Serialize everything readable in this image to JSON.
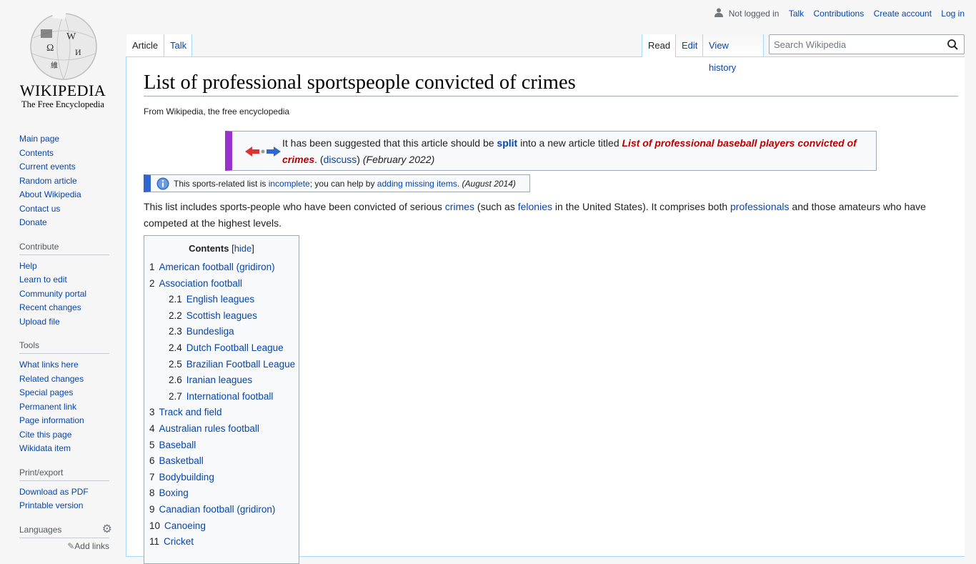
{
  "logo": {
    "wordmark": "WIKIPEDIA",
    "tagline": "The Free Encyclopedia"
  },
  "personal": {
    "not_logged_in": "Not logged in",
    "talk": "Talk",
    "contributions": "Contributions",
    "create_account": "Create account",
    "log_in": "Log in"
  },
  "tabs": {
    "article": "Article",
    "talk": "Talk",
    "read": "Read",
    "edit": "Edit",
    "view_history": "View history"
  },
  "search": {
    "placeholder": "Search Wikipedia"
  },
  "sidebar": {
    "main": [
      "Main page",
      "Contents",
      "Current events",
      "Random article",
      "About Wikipedia",
      "Contact us",
      "Donate"
    ],
    "contribute": {
      "heading": "Contribute",
      "items": [
        "Help",
        "Learn to edit",
        "Community portal",
        "Recent changes",
        "Upload file"
      ]
    },
    "tools": {
      "heading": "Tools",
      "items": [
        "What links here",
        "Related changes",
        "Special pages",
        "Permanent link",
        "Page information",
        "Cite this page",
        "Wikidata item"
      ]
    },
    "print": {
      "heading": "Print/export",
      "items": [
        "Download as PDF",
        "Printable version"
      ]
    },
    "languages": {
      "heading": "Languages",
      "add_links": "Add links"
    }
  },
  "article": {
    "title": "List of professional sportspeople convicted of crimes",
    "site_sub": "From Wikipedia, the free encyclopedia",
    "split_notice": {
      "pre": "It has been suggested that this article should be ",
      "split": "split",
      "mid": " into a new article titled ",
      "target": "List of professional baseball players convicted of crimes",
      "after_target": ". (",
      "discuss": "discuss",
      "close": ")",
      "date": "(February 2022)"
    },
    "incomplete_notice": {
      "pre": "This sports-related list is ",
      "incomplete": "incomplete",
      "mid": "; you can help by ",
      "adding": "adding missing items",
      "post": ". ",
      "date": "(August 2014)"
    },
    "intro": {
      "p1": "This list includes sports-people who have been convicted of serious ",
      "crimes": "crimes",
      "p2": " (such as ",
      "felonies": "felonies",
      "p3": " in the United States). It comprises both ",
      "professionals": "professionals",
      "p4": " and those amateurs who have competed at the highest levels."
    },
    "toc": {
      "title": "Contents",
      "hide": "hide",
      "items": [
        {
          "num": "1",
          "text": "American football (gridiron)",
          "level": 1
        },
        {
          "num": "2",
          "text": "Association football",
          "level": 1
        },
        {
          "num": "2.1",
          "text": "English leagues",
          "level": 2
        },
        {
          "num": "2.2",
          "text": "Scottish leagues",
          "level": 2
        },
        {
          "num": "2.3",
          "text": "Bundesliga",
          "level": 2
        },
        {
          "num": "2.4",
          "text": "Dutch Football League",
          "level": 2
        },
        {
          "num": "2.5",
          "text": "Brazilian Football League",
          "level": 2
        },
        {
          "num": "2.6",
          "text": "Iranian leagues",
          "level": 2
        },
        {
          "num": "2.7",
          "text": "International football",
          "level": 2
        },
        {
          "num": "3",
          "text": "Track and field",
          "level": 1
        },
        {
          "num": "4",
          "text": "Australian rules football",
          "level": 1
        },
        {
          "num": "5",
          "text": "Baseball",
          "level": 1
        },
        {
          "num": "6",
          "text": "Basketball",
          "level": 1
        },
        {
          "num": "7",
          "text": "Bodybuilding",
          "level": 1
        },
        {
          "num": "8",
          "text": "Boxing",
          "level": 1
        },
        {
          "num": "9",
          "text": "Canadian football (gridiron)",
          "level": 1
        },
        {
          "num": "10",
          "text": "Canoeing",
          "level": 1
        },
        {
          "num": "11",
          "text": "Cricket",
          "level": 1
        }
      ]
    }
  }
}
